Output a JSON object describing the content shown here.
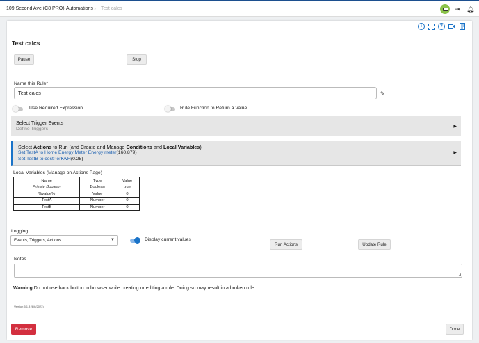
{
  "breadcrumb": {
    "hub": "109 Second Ave (C8 PRO)",
    "section": "Automations",
    "current": "Test calcs"
  },
  "toolbar_icons": [
    "hub-status-icon",
    "logout-icon",
    "notifications-bell-icon"
  ],
  "header_icons": [
    "info-icon",
    "fullscreen-icon",
    "help-icon",
    "video-icon",
    "document-icon"
  ],
  "page": {
    "title": "Test calcs"
  },
  "buttons": {
    "pause": "Pause",
    "stop": "Stop",
    "run_actions": "Run Actions",
    "update_rule": "Update Rule",
    "remove": "Remove",
    "done": "Done"
  },
  "name_field": {
    "label": "Name this Rule*",
    "value": "Test calcs"
  },
  "toggles": {
    "required_expression": {
      "label": "Use Required Expression",
      "on": false
    },
    "rule_function": {
      "label": "Rule Function to Return a Value",
      "on": false
    },
    "display_values": {
      "label": "Display current values",
      "on": true
    }
  },
  "trigger_section": {
    "title": "Select Trigger Events",
    "subtitle": "Define Triggers"
  },
  "actions_section": {
    "title_prefix": "Select ",
    "title_b1": "Actions",
    "title_mid1": " to Run (and Create and Manage ",
    "title_b2": "Conditions",
    "title_mid2": " and ",
    "title_b3": "Local Variables",
    "title_suffix": ")",
    "action1_link": "Set TestA to Home Energy Meter Energy meter",
    "action1_value": "(160.879)",
    "action2_link": "Set TestB to costPerKwH",
    "action2_value": "(0.25)"
  },
  "local_variables": {
    "title": "Local Variables",
    "manage_note": " (Manage on Actions Page)",
    "columns": [
      "Name",
      "Type",
      "Value"
    ],
    "rows": [
      [
        "Private Boolean",
        "Boolean",
        "true"
      ],
      [
        "%value%",
        "Value",
        "0"
      ],
      [
        "TestA",
        "Number",
        "0"
      ],
      [
        "TestB",
        "Number",
        "0"
      ]
    ]
  },
  "logging": {
    "label": "Logging",
    "selected": "Events, Triggers, Actions"
  },
  "notes": {
    "label": "Notes",
    "value": ""
  },
  "warning": {
    "bold": "Warning",
    "text": " Do not use back button in browser while creating or editing a rule. Doing so may result in a broken rule."
  },
  "version": "Version 5.1.8 (6/6/2023)",
  "colors": {
    "accent": "#1a73c8",
    "danger": "#d32f3f",
    "hub_status": "#8bc34a",
    "topbar_border": "#1c4f8f"
  }
}
